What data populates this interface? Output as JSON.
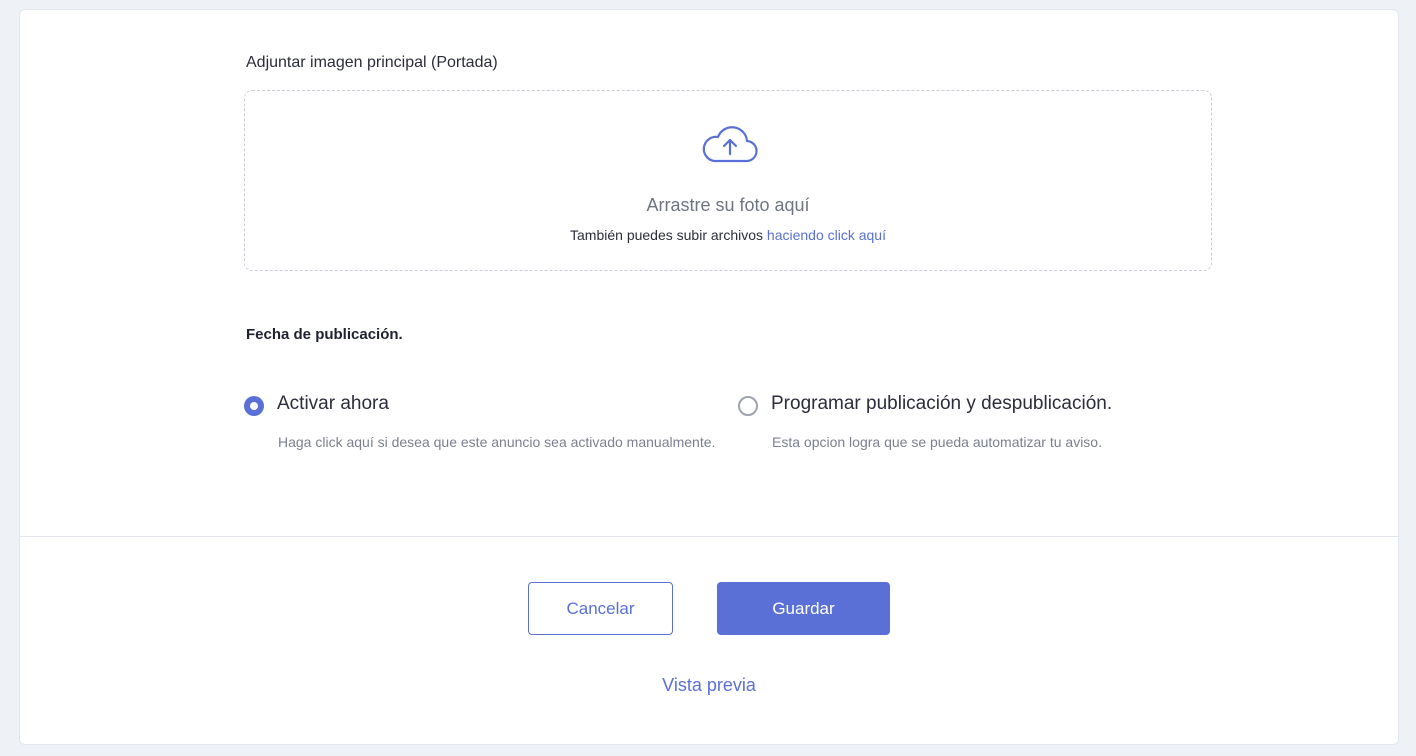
{
  "upload": {
    "label": "Adjuntar imagen principal (Portada)",
    "icon": "cloud-upload-icon",
    "title": "Arrastre su foto aquí",
    "subtitle": "También puedes subir archivos",
    "link": "haciendo click aquí"
  },
  "publication": {
    "title": "Fecha de publicación.",
    "options": [
      {
        "label": "Activar ahora",
        "description": "Haga click aquí si desea que este anuncio sea activado manualmente.",
        "checked": true
      },
      {
        "label": "Programar publicación y despublicación.",
        "description": "Esta opcion logra que se pueda automatizar tu aviso.",
        "checked": false
      }
    ]
  },
  "actions": {
    "cancel": "Cancelar",
    "save": "Guardar",
    "preview": "Vista previa"
  },
  "colors": {
    "accent": "#5a70d6",
    "background": "#eef1f6"
  }
}
